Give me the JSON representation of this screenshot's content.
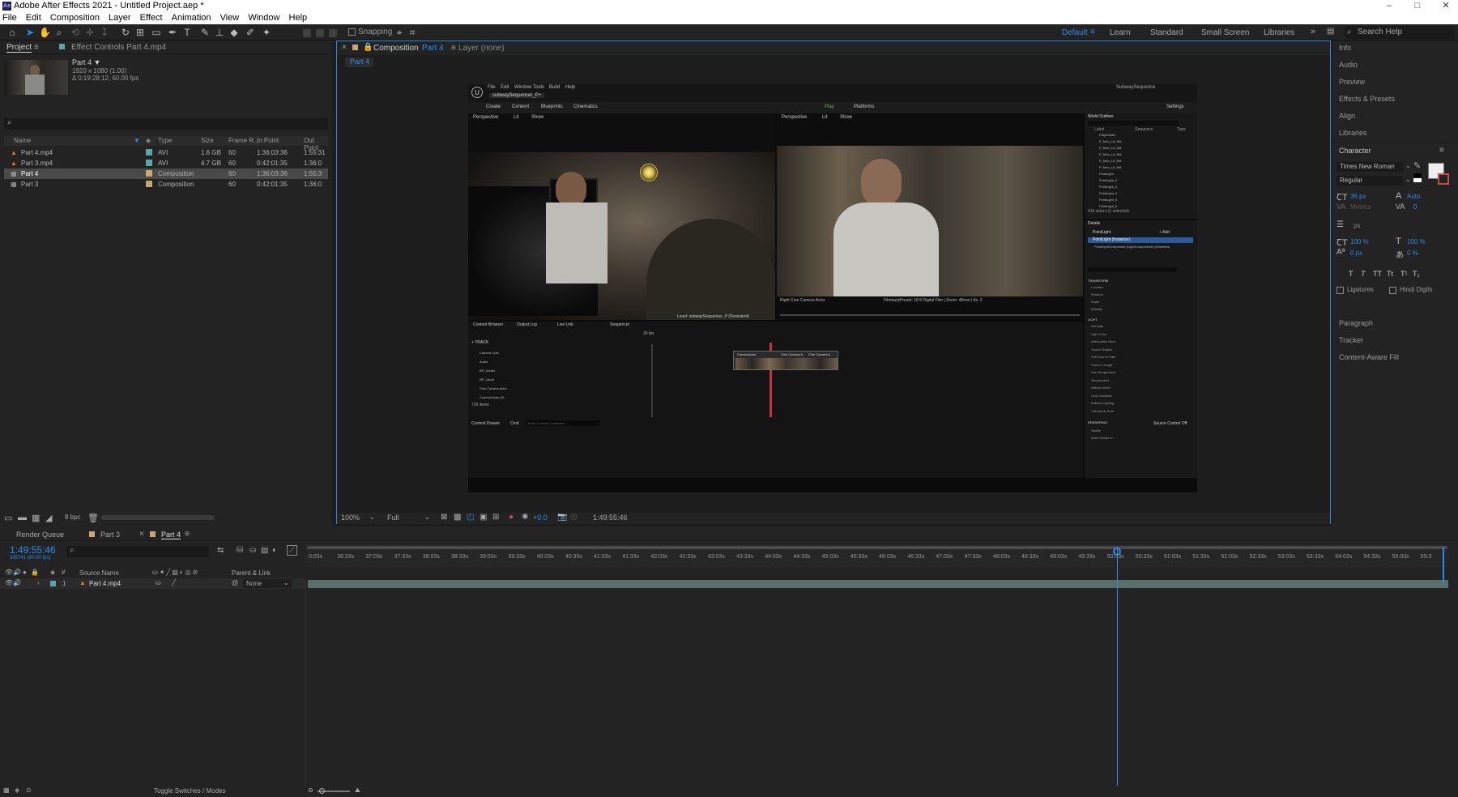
{
  "window": {
    "title": "Adobe After Effects 2021 - Untitled Project.aep *",
    "app_icon": "Ae",
    "controls": [
      "–",
      "□",
      "✕"
    ]
  },
  "menu": [
    "File",
    "Edit",
    "Composition",
    "Layer",
    "Effect",
    "Animation",
    "View",
    "Window",
    "Help"
  ],
  "toolbar": {
    "snapping_label": "Snapping",
    "workspaces": [
      "Default",
      "Learn",
      "Standard",
      "Small Screen",
      "Libraries"
    ],
    "active_workspace": "Default",
    "search_placeholder": "Search Help"
  },
  "project_panel": {
    "tab_project": "Project",
    "tab_effect_controls": "Effect Controls Part 4.mp4",
    "selected_name": "Part 4 ▼",
    "selected_res": "1920 x 1080 (1.00)",
    "selected_duration": "Δ 0:19:28:12, 60.00 fps",
    "columns": [
      "Name",
      "Type",
      "Size",
      "Frame R...",
      "In Point",
      "Out Point"
    ],
    "rows": [
      {
        "name": "Part 4.mp4",
        "type": "AVI",
        "size": "1.6 GB",
        "fps": "60",
        "in": "1:36:03:36",
        "out": "1:55:31"
      },
      {
        "name": "Part 3.mp4",
        "type": "AVI",
        "size": "4.7 GB",
        "fps": "60",
        "in": "0:42:01:35",
        "out": "1:36:0"
      },
      {
        "name": "Part 4",
        "type": "Composition",
        "size": "",
        "fps": "60",
        "in": "1:36:03:36",
        "out": "1:55:3"
      },
      {
        "name": "Part 3",
        "type": "Composition",
        "size": "",
        "fps": "60",
        "in": "0:42:01:35",
        "out": "1:36:0"
      }
    ],
    "bpc": "8 bpc"
  },
  "composition_panel": {
    "tab_label": "Composition",
    "tab_comp_name": "Part 4",
    "layer_label": "Layer (none)",
    "breadcrumb": "Part 4",
    "zoom": "100%",
    "resolution": "Full",
    "exposure": "+0.0",
    "timecode": "1:49:55:46"
  },
  "ue_screen": {
    "menu": [
      "File",
      "Edit",
      "Window",
      "Tools",
      "Build",
      "Help"
    ],
    "tab": "subwaySequencer_P+",
    "map": "SubwaySequence",
    "toolbar": [
      "Create",
      "Content",
      "Blueprints",
      "Cinematics"
    ],
    "play": "Play",
    "platforms": "Platforms",
    "settings": "Settings",
    "viewport_btns": [
      "Perspective",
      "Lit",
      "Show"
    ],
    "outliner_title": "World Outliner",
    "outliner_cols": [
      "Label",
      "Sequence",
      "Type"
    ],
    "outliner_items": [
      "PlayerStart",
      "P_Mon_Lit_Std",
      "P_Mon_Lit_Std",
      "P_Mon_Lit_Std",
      "P_Mon_Lit_Std",
      "P_Mon_Lit_Std",
      "PointLight",
      "PointLight_2",
      "PointLight_3",
      "PointLight_4",
      "PointLight_5",
      "PointLight_6"
    ],
    "actor_count": "419 actors (1 selected)",
    "details_title": "Details",
    "details_name": "PointLight",
    "details_add": "+ Add",
    "details_instance": "PointLight (Instance)",
    "details_component": "PointLightComponent (LightComponent0) (Inherited)",
    "transform_label": "TRANSFORM",
    "transform_rows": [
      "Location",
      "Rotation",
      "Scale",
      "Mobility"
    ],
    "light_label": "LIGHT",
    "light_rows": [
      "Intensity",
      "Light Color",
      "Attenuation Radi",
      "Source Radius",
      "Soft Source Radi",
      "Source Length",
      "Use Temperature",
      "Temperature",
      "Affects World",
      "Cast Shadows",
      "Indirect Lighting",
      "Volumetric Scat"
    ],
    "rendering_label": "RENDERING",
    "rendering_rows": [
      "Visible",
      "Actor Hidden In"
    ],
    "cam_label": "Right Cine Camera Actor",
    "film_label": "FilmbackPreset: 16:9 Digital Film | Zoom: 45mm | Av: 2",
    "level_label": "Level: subwaySequencer_P (Persistent)",
    "bottom_tabs": [
      "Content Browser",
      "Output Log",
      "Live Link",
      "Sequencer"
    ],
    "track_label": "+ TRACK",
    "tracks": [
      "Camera Cuts",
      "Audio",
      "BP_Adrian",
      "BP_Jason",
      "Cine Camera Actor",
      "Camera Actor (2)"
    ],
    "item_count": "716 items",
    "fps_label": "30 fps",
    "content_drawer": "Content Drawer",
    "cmd_label": "Cmd",
    "console_placeholder": "Enter Console Command",
    "source_control": "Source Control Off",
    "clip_labels": [
      "CameraActor",
      "Cine Camera A",
      "Cine Camera A"
    ]
  },
  "right_panel": {
    "items_top": [
      "Info",
      "Audio",
      "Preview",
      "Effects & Presets",
      "Align",
      "Libraries"
    ],
    "character_title": "Character",
    "font": "Times New Roman",
    "style": "Regular",
    "font_size": "36 px",
    "leading": "Auto",
    "kerning": "Metrics",
    "tracking": "0",
    "stroke_width": "px",
    "vert_scale": "100 %",
    "horiz_scale": "100 %",
    "baseline": "0 px",
    "tsume": "0 %",
    "style_buttons": [
      "T",
      "T",
      "TT",
      "Tt",
      "T¹",
      "T₁"
    ],
    "ligatures": "Ligatures",
    "hindi_digits": "Hindi Digits",
    "items_bottom": [
      "Paragraph",
      "Tracker",
      "Content-Aware Fill"
    ]
  },
  "timeline": {
    "tabs": [
      "Render Queue",
      "Part 3",
      "Part 4"
    ],
    "active_tab": "Part 4",
    "current_time": "1:49:55:46",
    "frames": "395741 (60.00 fps)",
    "col_source": "Source Name",
    "col_parent": "Parent & Link",
    "layer_num": "1",
    "layer_name": "Part 4.mp4",
    "parent_value": "None",
    "ticks": [
      "0:03s",
      "36:33s",
      "37:03s",
      "37:33s",
      "38:03s",
      "38:33s",
      "39:03s",
      "39:33s",
      "40:03s",
      "40:33s",
      "41:03s",
      "41:33s",
      "42:03s",
      "42:33s",
      "43:03s",
      "43:33s",
      "44:03s",
      "44:33s",
      "45:03s",
      "45:33s",
      "46:03s",
      "46:33s",
      "47:03s",
      "47:33s",
      "48:03s",
      "48:33s",
      "49:03s",
      "49:33s",
      "50:03s",
      "50:33s",
      "51:03s",
      "51:33s",
      "52:03s",
      "52:33s",
      "53:03s",
      "53:33s",
      "54:03s",
      "54:33s",
      "55:03s",
      "55:3"
    ],
    "toggle_label": "Toggle Switches / Modes"
  },
  "colors": {
    "accent": "#2d8ceb",
    "panel_bg": "#232323",
    "label_avi": "#58a6a6",
    "label_comp": "#c8a676",
    "layer_bar": "#5a6e6a"
  }
}
